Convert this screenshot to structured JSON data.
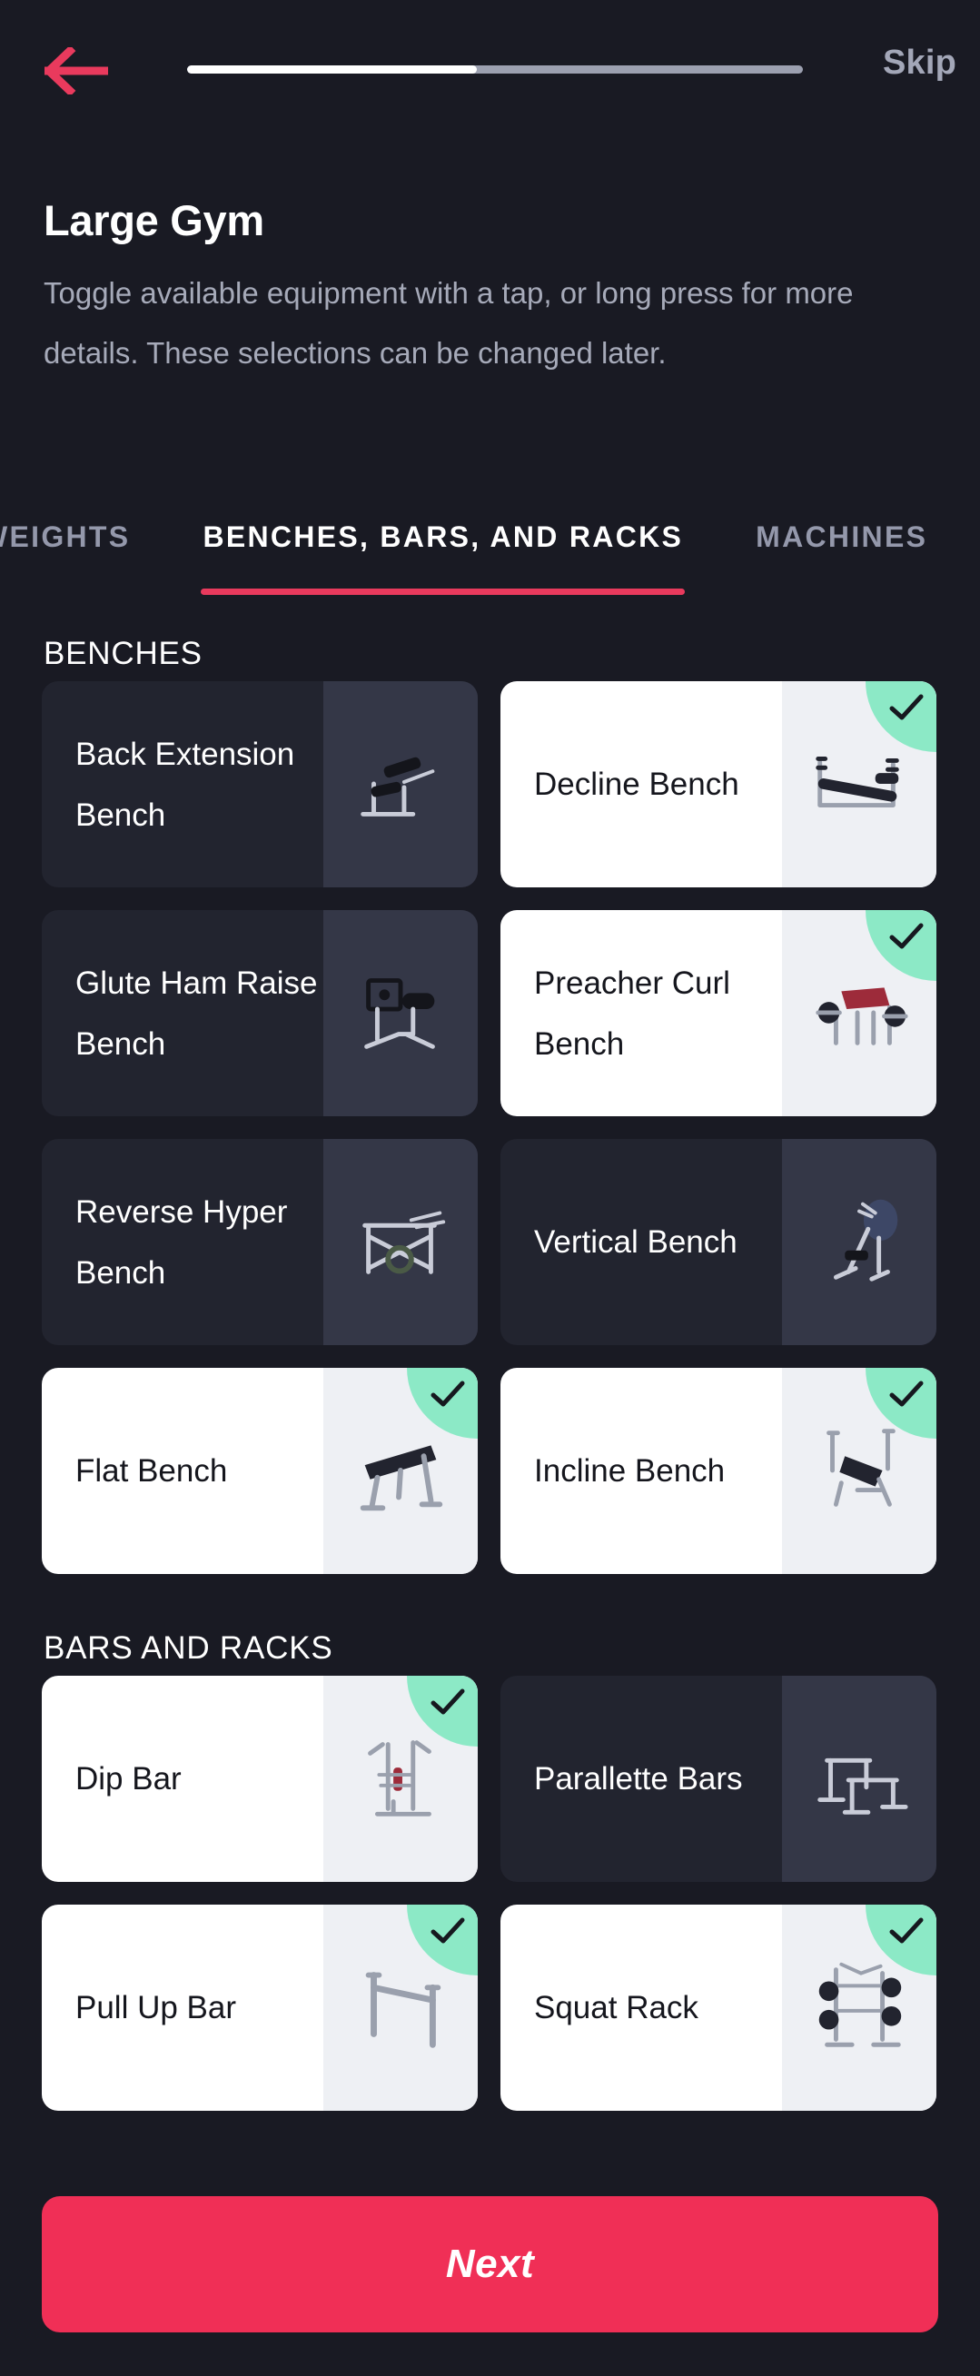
{
  "topbar": {
    "back_icon": "arrow-left-icon",
    "skip_label": "Skip",
    "progress_percent": 47
  },
  "header": {
    "title": "Large Gym",
    "subtitle": "Toggle available equipment with a tap, or long press for more details. These selections can be changed later."
  },
  "tabs": [
    {
      "label": "WEIGHTS",
      "active": false
    },
    {
      "label": "BENCHES, BARS, AND RACKS",
      "active": true
    },
    {
      "label": "MACHINES",
      "active": false
    }
  ],
  "sections": [
    {
      "label": "BENCHES",
      "items": [
        {
          "label": "Back Extension Bench",
          "selected": false,
          "icon": "back-extension-bench-icon"
        },
        {
          "label": "Decline Bench",
          "selected": true,
          "icon": "decline-bench-icon"
        },
        {
          "label": "Glute Ham Raise Bench",
          "selected": false,
          "icon": "glute-ham-raise-bench-icon"
        },
        {
          "label": "Preacher Curl Bench",
          "selected": true,
          "icon": "preacher-curl-bench-icon"
        },
        {
          "label": "Reverse Hyper Bench",
          "selected": false,
          "icon": "reverse-hyper-bench-icon"
        },
        {
          "label": "Vertical Bench",
          "selected": false,
          "icon": "vertical-bench-icon"
        },
        {
          "label": "Flat Bench",
          "selected": true,
          "icon": "flat-bench-icon"
        },
        {
          "label": "Incline Bench",
          "selected": true,
          "icon": "incline-bench-icon"
        }
      ]
    },
    {
      "label": "BARS AND RACKS",
      "items": [
        {
          "label": "Dip Bar",
          "selected": true,
          "icon": "dip-bar-icon"
        },
        {
          "label": "Parallette Bars",
          "selected": false,
          "icon": "parallette-bars-icon"
        },
        {
          "label": "Pull Up Bar",
          "selected": true,
          "icon": "pull-up-bar-icon"
        },
        {
          "label": "Squat Rack",
          "selected": true,
          "icon": "squat-rack-icon"
        }
      ]
    }
  ],
  "footer": {
    "next_label": "Next"
  },
  "colors": {
    "background": "#191a23",
    "accent": "#f02f56",
    "tab_underline": "#e93a5d",
    "check_badge": "#8ce9c6",
    "card_unselected": "#22242f",
    "card_image_unselected": "#343747",
    "card_selected": "#ffffff",
    "card_image_selected": "#eef0f4",
    "muted_text": "#a6aab9"
  }
}
